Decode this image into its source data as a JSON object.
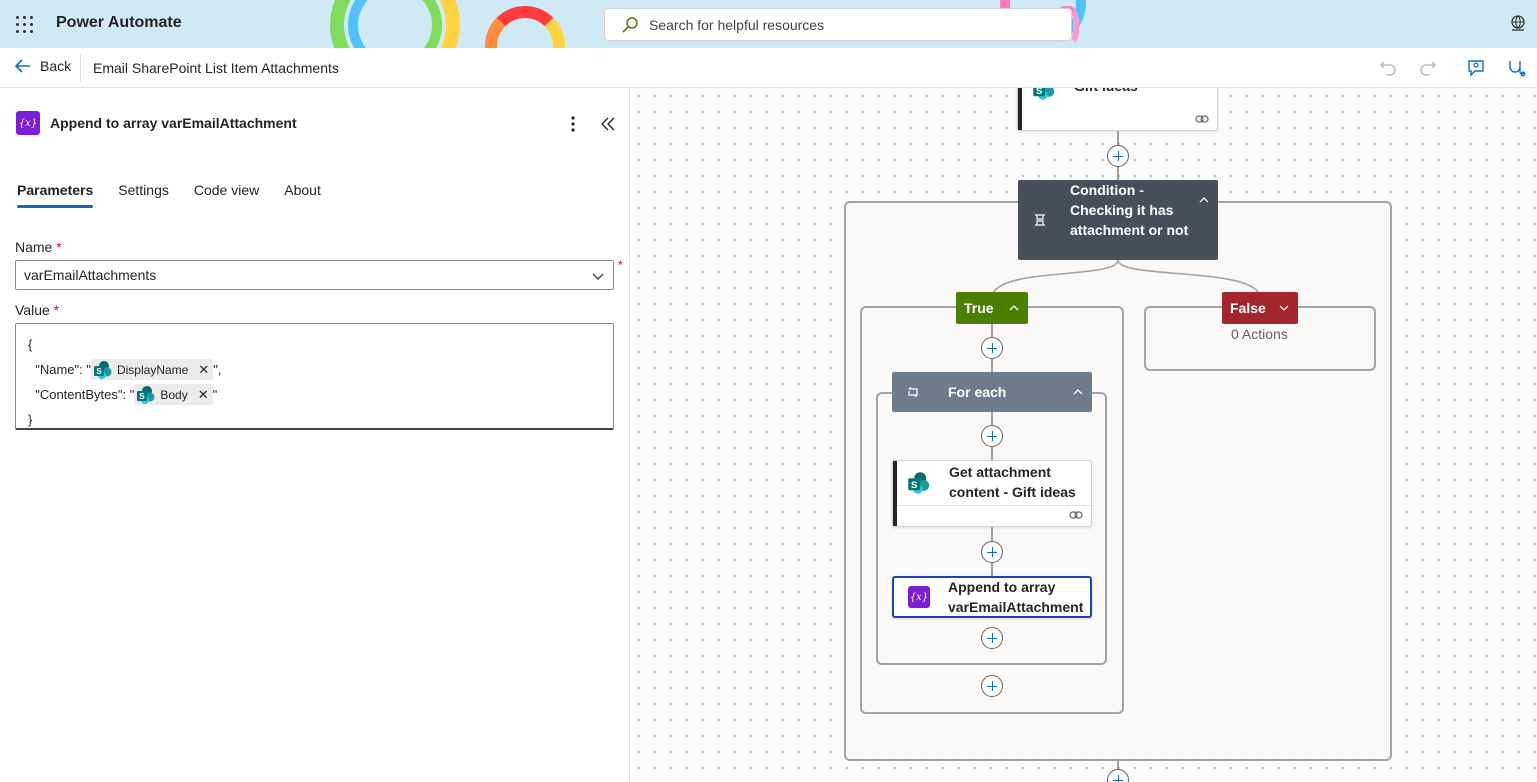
{
  "topbar": {
    "app_title": "Power Automate",
    "search_placeholder": "Search for helpful resources",
    "colors": {
      "background": "#cfe9f5"
    }
  },
  "commandbar": {
    "back_label": "Back",
    "flow_name": "Email SharePoint List Item Attachments",
    "icons": [
      "undo-icon",
      "redo-icon",
      "feedback-icon",
      "flow-checker-icon"
    ]
  },
  "panel": {
    "title": "Append to array varEmailAttachment",
    "tabs": [
      {
        "label": "Parameters",
        "active": true
      },
      {
        "label": "Settings",
        "active": false
      },
      {
        "label": "Code view",
        "active": false
      },
      {
        "label": "About",
        "active": false
      }
    ],
    "name_label": "Name",
    "required_mark": "*",
    "name_value": "varEmailAttachments",
    "value_label": "Value",
    "value_lines": {
      "open": "{",
      "name_key": "  \"Name\": \"",
      "name_token": "DisplayName",
      "name_suffix": "\",",
      "content_key": "  \"ContentBytes\": \"",
      "content_token": "Body",
      "content_suffix": "\"",
      "close": "}"
    }
  },
  "canvas": {
    "top_card_title": "Gift ideas",
    "condition_title": "Condition - Checking it has attachment or not",
    "true_label": "True",
    "false_label": "False",
    "false_actions": "0 Actions",
    "foreach_label": "For each",
    "get_attachment_title": "Get attachment content - Gift ideas",
    "append_title": "Append to array varEmailAttachment",
    "colors": {
      "condition": "#484f58",
      "true": "#4b7f02",
      "false": "#a4262c",
      "foreach": "#6d7c8d",
      "variable": "#7a1fd6",
      "selected_border": "#1f3fb7"
    }
  }
}
